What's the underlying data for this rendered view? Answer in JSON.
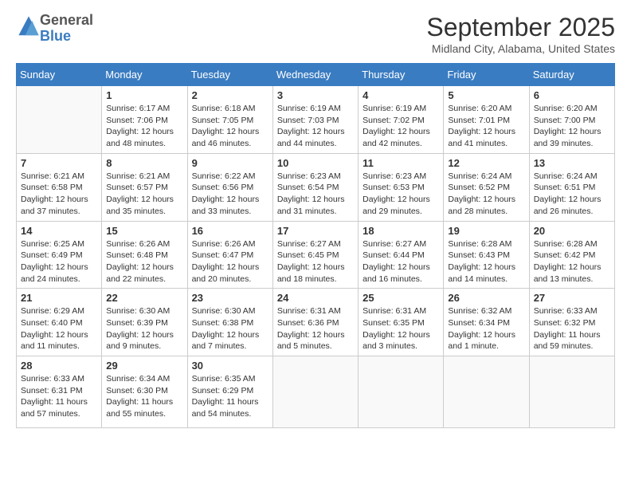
{
  "header": {
    "logo": {
      "general": "General",
      "blue": "Blue"
    },
    "title": "September 2025",
    "location": "Midland City, Alabama, United States"
  },
  "weekdays": [
    "Sunday",
    "Monday",
    "Tuesday",
    "Wednesday",
    "Thursday",
    "Friday",
    "Saturday"
  ],
  "weeks": [
    [
      {
        "day": "",
        "info": ""
      },
      {
        "day": "1",
        "info": "Sunrise: 6:17 AM\nSunset: 7:06 PM\nDaylight: 12 hours\nand 48 minutes."
      },
      {
        "day": "2",
        "info": "Sunrise: 6:18 AM\nSunset: 7:05 PM\nDaylight: 12 hours\nand 46 minutes."
      },
      {
        "day": "3",
        "info": "Sunrise: 6:19 AM\nSunset: 7:03 PM\nDaylight: 12 hours\nand 44 minutes."
      },
      {
        "day": "4",
        "info": "Sunrise: 6:19 AM\nSunset: 7:02 PM\nDaylight: 12 hours\nand 42 minutes."
      },
      {
        "day": "5",
        "info": "Sunrise: 6:20 AM\nSunset: 7:01 PM\nDaylight: 12 hours\nand 41 minutes."
      },
      {
        "day": "6",
        "info": "Sunrise: 6:20 AM\nSunset: 7:00 PM\nDaylight: 12 hours\nand 39 minutes."
      }
    ],
    [
      {
        "day": "7",
        "info": "Sunrise: 6:21 AM\nSunset: 6:58 PM\nDaylight: 12 hours\nand 37 minutes."
      },
      {
        "day": "8",
        "info": "Sunrise: 6:21 AM\nSunset: 6:57 PM\nDaylight: 12 hours\nand 35 minutes."
      },
      {
        "day": "9",
        "info": "Sunrise: 6:22 AM\nSunset: 6:56 PM\nDaylight: 12 hours\nand 33 minutes."
      },
      {
        "day": "10",
        "info": "Sunrise: 6:23 AM\nSunset: 6:54 PM\nDaylight: 12 hours\nand 31 minutes."
      },
      {
        "day": "11",
        "info": "Sunrise: 6:23 AM\nSunset: 6:53 PM\nDaylight: 12 hours\nand 29 minutes."
      },
      {
        "day": "12",
        "info": "Sunrise: 6:24 AM\nSunset: 6:52 PM\nDaylight: 12 hours\nand 28 minutes."
      },
      {
        "day": "13",
        "info": "Sunrise: 6:24 AM\nSunset: 6:51 PM\nDaylight: 12 hours\nand 26 minutes."
      }
    ],
    [
      {
        "day": "14",
        "info": "Sunrise: 6:25 AM\nSunset: 6:49 PM\nDaylight: 12 hours\nand 24 minutes."
      },
      {
        "day": "15",
        "info": "Sunrise: 6:26 AM\nSunset: 6:48 PM\nDaylight: 12 hours\nand 22 minutes."
      },
      {
        "day": "16",
        "info": "Sunrise: 6:26 AM\nSunset: 6:47 PM\nDaylight: 12 hours\nand 20 minutes."
      },
      {
        "day": "17",
        "info": "Sunrise: 6:27 AM\nSunset: 6:45 PM\nDaylight: 12 hours\nand 18 minutes."
      },
      {
        "day": "18",
        "info": "Sunrise: 6:27 AM\nSunset: 6:44 PM\nDaylight: 12 hours\nand 16 minutes."
      },
      {
        "day": "19",
        "info": "Sunrise: 6:28 AM\nSunset: 6:43 PM\nDaylight: 12 hours\nand 14 minutes."
      },
      {
        "day": "20",
        "info": "Sunrise: 6:28 AM\nSunset: 6:42 PM\nDaylight: 12 hours\nand 13 minutes."
      }
    ],
    [
      {
        "day": "21",
        "info": "Sunrise: 6:29 AM\nSunset: 6:40 PM\nDaylight: 12 hours\nand 11 minutes."
      },
      {
        "day": "22",
        "info": "Sunrise: 6:30 AM\nSunset: 6:39 PM\nDaylight: 12 hours\nand 9 minutes."
      },
      {
        "day": "23",
        "info": "Sunrise: 6:30 AM\nSunset: 6:38 PM\nDaylight: 12 hours\nand 7 minutes."
      },
      {
        "day": "24",
        "info": "Sunrise: 6:31 AM\nSunset: 6:36 PM\nDaylight: 12 hours\nand 5 minutes."
      },
      {
        "day": "25",
        "info": "Sunrise: 6:31 AM\nSunset: 6:35 PM\nDaylight: 12 hours\nand 3 minutes."
      },
      {
        "day": "26",
        "info": "Sunrise: 6:32 AM\nSunset: 6:34 PM\nDaylight: 12 hours\nand 1 minute."
      },
      {
        "day": "27",
        "info": "Sunrise: 6:33 AM\nSunset: 6:32 PM\nDaylight: 11 hours\nand 59 minutes."
      }
    ],
    [
      {
        "day": "28",
        "info": "Sunrise: 6:33 AM\nSunset: 6:31 PM\nDaylight: 11 hours\nand 57 minutes."
      },
      {
        "day": "29",
        "info": "Sunrise: 6:34 AM\nSunset: 6:30 PM\nDaylight: 11 hours\nand 55 minutes."
      },
      {
        "day": "30",
        "info": "Sunrise: 6:35 AM\nSunset: 6:29 PM\nDaylight: 11 hours\nand 54 minutes."
      },
      {
        "day": "",
        "info": ""
      },
      {
        "day": "",
        "info": ""
      },
      {
        "day": "",
        "info": ""
      },
      {
        "day": "",
        "info": ""
      }
    ]
  ]
}
